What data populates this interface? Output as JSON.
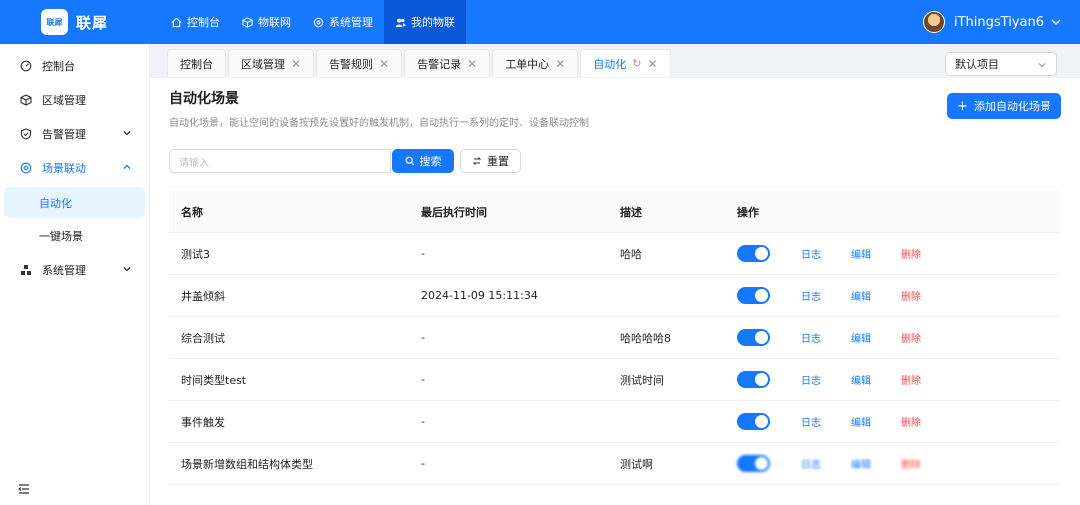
{
  "brand": {
    "logo_label": "联犀",
    "name": "联犀"
  },
  "topnav": [
    {
      "label": "控制台",
      "icon": "home-icon"
    },
    {
      "label": "物联网",
      "icon": "cube-icon"
    },
    {
      "label": "系统管理",
      "icon": "settings-icon"
    },
    {
      "label": "我的物联",
      "icon": "users-icon",
      "active": true
    }
  ],
  "user": {
    "name": "iThingsTiyan6"
  },
  "sidebar": {
    "items": [
      {
        "label": "控制台",
        "icon": "dashboard-icon"
      },
      {
        "label": "区域管理",
        "icon": "cube-icon"
      },
      {
        "label": "告警管理",
        "icon": "shield-icon"
      },
      {
        "label": "场景联动",
        "icon": "scene-icon"
      },
      {
        "label": "系统管理",
        "icon": "cluster-icon"
      }
    ],
    "sub": [
      {
        "label": "自动化",
        "selected": true
      },
      {
        "label": "一键场景"
      }
    ]
  },
  "tabs": [
    {
      "label": "控制台"
    },
    {
      "label": "区域管理"
    },
    {
      "label": "告警规则"
    },
    {
      "label": "告警记录"
    },
    {
      "label": "工单中心"
    },
    {
      "label": "自动化",
      "active": true
    }
  ],
  "project_select": {
    "value": "默认项目"
  },
  "page": {
    "title": "自动化场景",
    "description": "自动化场景，能让空间的设备按预先设置好的触发机制，自动执行一系列的定时、设备联动控制",
    "add_button": "添加自动化场景"
  },
  "search": {
    "placeholder": "请输入",
    "search_label": "搜索",
    "reset_label": "重置"
  },
  "table": {
    "headers": [
      "名称",
      "最后执行时间",
      "描述",
      "操作"
    ],
    "actions": {
      "log": "日志",
      "edit": "编辑",
      "delete": "删除"
    },
    "rows": [
      {
        "name": "测试3",
        "last_run": "-",
        "desc": "哈哈",
        "enabled": true
      },
      {
        "name": "井盖倾斜",
        "last_run": "2024-11-09 15:11:34",
        "desc": "",
        "enabled": true
      },
      {
        "name": "综合测试",
        "last_run": "-",
        "desc": "哈哈哈哈8",
        "enabled": true
      },
      {
        "name": "时间类型test",
        "last_run": "-",
        "desc": "测试时间",
        "enabled": true
      },
      {
        "name": "事件触发",
        "last_run": "-",
        "desc": "",
        "enabled": true
      },
      {
        "name": "场景新增数组和结构体类型",
        "last_run": "-",
        "desc": "测试啊",
        "enabled": true
      }
    ]
  },
  "colors": {
    "primary": "#1677ff",
    "danger": "#ff4d4f"
  }
}
